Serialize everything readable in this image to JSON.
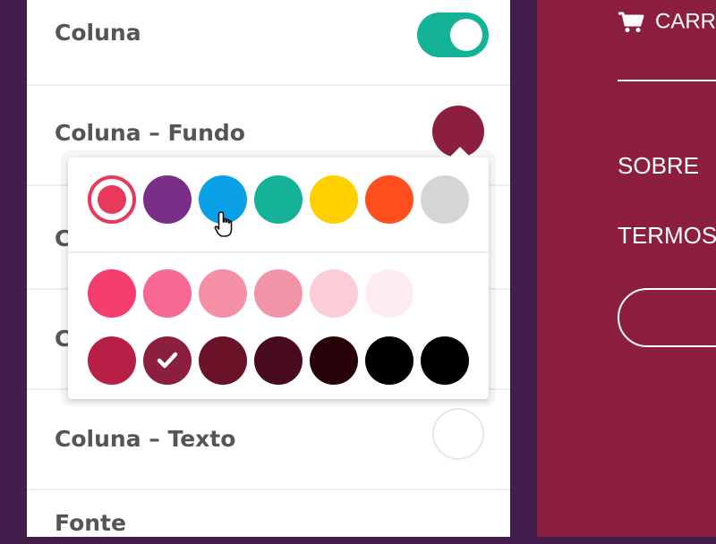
{
  "settings": {
    "rows": [
      {
        "label": "Coluna",
        "control": "toggle",
        "on": true
      },
      {
        "label": "Coluna – Fundo",
        "control": "color",
        "value": "#8c1f3e"
      },
      {
        "label": "C",
        "control": "hidden"
      },
      {
        "label": "C",
        "control": "hidden"
      },
      {
        "label": "Coluna – Texto",
        "control": "color",
        "value": "#ffffff"
      },
      {
        "label": "Fonte",
        "control": "none"
      }
    ]
  },
  "colors": {
    "accent": "#14b297",
    "sidebar_bg": "#421c4b",
    "preview_bg": "#8c1f3e",
    "text": "#555555"
  },
  "palette": {
    "base": [
      "#e8395b",
      "#7a2e88",
      "#0aa0e8",
      "#14b297",
      "#ffcf00",
      "#ff4f1f",
      "#d5d5d5"
    ],
    "selected_base_index": 0,
    "tints": [
      "#f43f6e",
      "#f76892",
      "#f58fa6",
      "#f293a8",
      "#fccdd7",
      "#fdecf4"
    ],
    "shades": [
      "#b81f46",
      "#8c1f3e",
      "#6b1429",
      "#480a20",
      "#270208",
      "#000000",
      "#000000"
    ],
    "selected_shade_index": 1
  },
  "icons": {
    "check": "check-icon",
    "cursor": "pointer-hand-icon",
    "cart": "cart-icon"
  },
  "preview": {
    "cart_label": "CARR",
    "links": [
      "SOBRE",
      "TERMOS"
    ]
  }
}
